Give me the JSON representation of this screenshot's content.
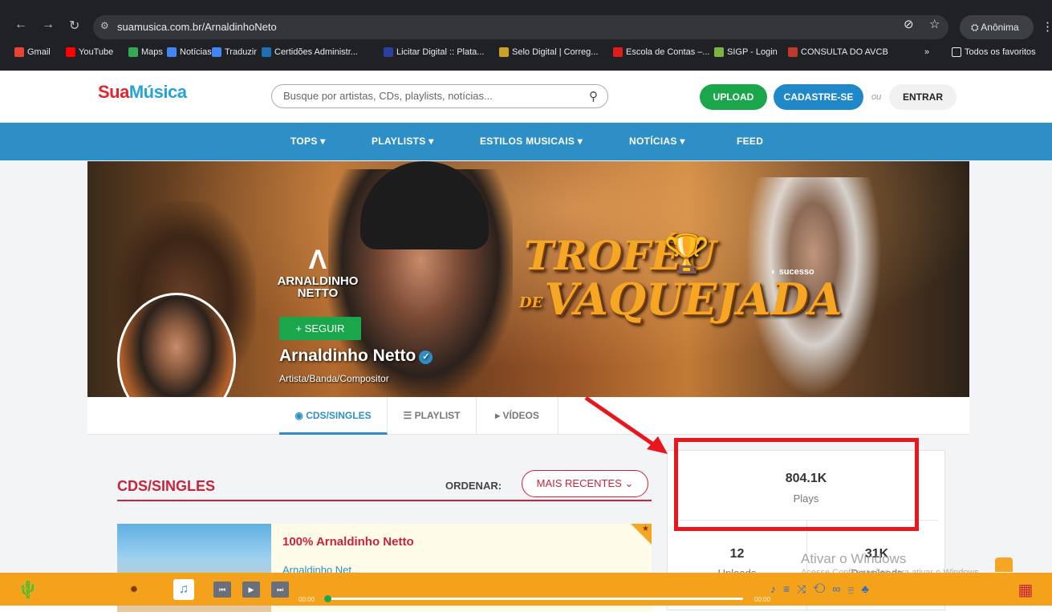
{
  "browser": {
    "url": "suamusica.com.br/ArnaldinhoNeto",
    "incognito_label": "Anônima",
    "bookmarks": [
      {
        "label": "Gmail",
        "color": "#ea4335"
      },
      {
        "label": "YouTube",
        "color": "#ff0000"
      },
      {
        "label": "Maps",
        "color": "#34a853"
      },
      {
        "label": "Notícias",
        "color": "#4285f4"
      },
      {
        "label": "Traduzir",
        "color": "#4285f4"
      },
      {
        "label": "Certidões Administr...",
        "color": "#1f6fb5"
      },
      {
        "label": "Licitar Digital :: Plata...",
        "color": "#2a3f9e"
      },
      {
        "label": "Selo Digital | Correg...",
        "color": "#c9a227"
      },
      {
        "label": "Escola de Contas –...",
        "color": "#e21b1b"
      },
      {
        "label": "SIGP - Login",
        "color": "#7fb240"
      },
      {
        "label": "CONSULTA DO AVCB",
        "color": "#c0392b"
      }
    ],
    "bookmarks_more": "»",
    "all_bookmarks": "Todos os favoritos"
  },
  "header": {
    "logo_sua": "Sua",
    "logo_musica": "Música",
    "search_placeholder": "Busque por artistas, CDs, playlists, notícias...",
    "upload_label": "UPLOAD",
    "cadastre_label": "CADASTRE-SE",
    "ou_label": "ou",
    "entrar_label": "ENTRAR"
  },
  "menu": [
    {
      "label": "TOPS ▾"
    },
    {
      "label": "PLAYLISTS ▾"
    },
    {
      "label": "ESTILOS MUSICAIS ▾"
    },
    {
      "label": "NOTÍCIAS ▾"
    },
    {
      "label": "FEED"
    }
  ],
  "banner": {
    "logo_line1": "ARNALDINHO",
    "logo_line2": "NETTO",
    "trofeu": "TROFÉU",
    "de": "DE",
    "vaquejada": "VAQUEJADA",
    "sucesso": "sucesso"
  },
  "artist": {
    "follow_label": "+ SEGUIR",
    "name": "Arnaldinho Netto",
    "subtitle": "Artista/Banda/Compositor"
  },
  "tabs": [
    {
      "label": "◉ CDS/SINGLES"
    },
    {
      "label": "☰ PLAYLIST"
    },
    {
      "label": "▸ VÍDEOS"
    }
  ],
  "cds": {
    "title": "CDS/SINGLES",
    "order_label": "ORDENAR:",
    "order_value": "MAIS RECENTES",
    "album_title": "100% Arnaldinho Netto",
    "album_artist": "Arnaldinho Net..."
  },
  "stats": {
    "plays_value": "804.1K",
    "plays_label": "Plays",
    "uploads_value": "12",
    "uploads_label": "Uploads",
    "downloads_value": "31K",
    "downloads_label": "Downloads"
  },
  "windows": {
    "activate": "Ativar o Windows",
    "activate_sub": "Acesse Configurações para ativar o Windows."
  },
  "player": {
    "time_start": "00:00",
    "time_end": "00:00"
  }
}
